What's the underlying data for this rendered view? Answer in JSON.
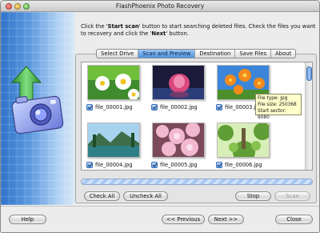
{
  "window": {
    "title": "FlashPhoenix Photo Recovery"
  },
  "instructions": {
    "part1": "Click the '",
    "start_scan_ref": "Start scan",
    "part2": "' button to start searching deleted files. Check the files you want to recovery and click the '",
    "next_ref": "Next",
    "part3": "' button."
  },
  "tabs": [
    {
      "label": "Select Drive",
      "active": false
    },
    {
      "label": "Scan and Preview",
      "active": true
    },
    {
      "label": "Destination",
      "active": false
    },
    {
      "label": "Save Files",
      "active": false
    },
    {
      "label": "About",
      "active": false
    }
  ],
  "files": [
    {
      "name": "file_00001.jpg",
      "checked": true,
      "thumb": "daisies-icon"
    },
    {
      "name": "file_00002.jpg",
      "checked": true,
      "thumb": "pink-flower-icon"
    },
    {
      "name": "file_00003.jpg",
      "checked": true,
      "thumb": "orange-flowers-icon"
    },
    {
      "name": "file_00004.jpg",
      "checked": true,
      "thumb": "landscape-icon"
    },
    {
      "name": "file_00005.jpg",
      "checked": true,
      "thumb": "cherry-blossom-icon"
    },
    {
      "name": "file_00006.jpg",
      "checked": true,
      "thumb": "forest-icon"
    }
  ],
  "tooltip": {
    "line1": "File type: jpg",
    "line2": "File size: 250368",
    "line3": "Start sector: 9080"
  },
  "buttons": {
    "check_all": "Check All",
    "uncheck_all": "Uncheck All",
    "stop": "Stop",
    "scan": "Scan",
    "help": "Help",
    "previous": "<< Previous",
    "next": "Next >>",
    "close": "Close"
  },
  "colors": {
    "accent": "#4e93e0",
    "tooltip_bg": "#ffffcc"
  }
}
